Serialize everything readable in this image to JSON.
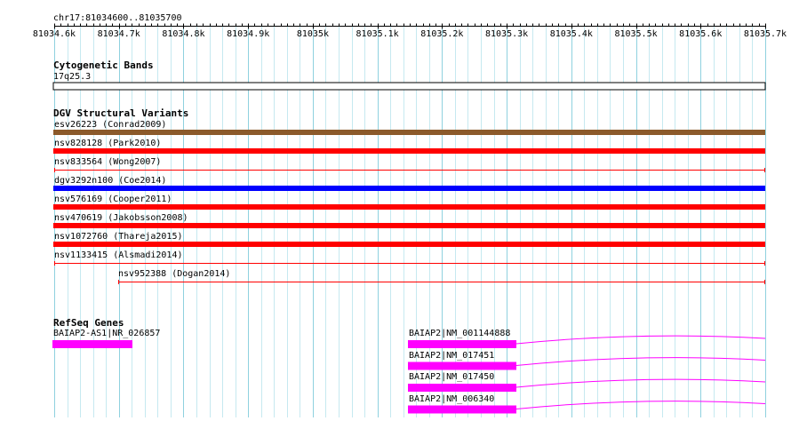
{
  "ruler": {
    "location": "chr17:81034600..81035700",
    "ticks": [
      "81034.6k",
      "81034.7k",
      "81034.8k",
      "81034.9k",
      "81035k",
      "81035.1k",
      "81035.2k",
      "81035.3k",
      "81035.4k",
      "81035.5k",
      "81035.6k",
      "81035.7k"
    ]
  },
  "tracks": {
    "cytoband": {
      "title": "Cytogenetic Bands",
      "band": "17q25.3"
    },
    "dgv": {
      "title": "DGV Structural Variants",
      "features": [
        {
          "label": "esv26223 (Conrad2009)",
          "color": "#8b5a2b",
          "style": "thick",
          "start": 0,
          "end": 1
        },
        {
          "label": "nsv828128 (Park2010)",
          "color": "#ff0000",
          "style": "thick",
          "start": 0,
          "end": 1
        },
        {
          "label": "nsv833564 (Wong2007)",
          "color": "#ff0000",
          "style": "thin",
          "start": 0,
          "end": 1
        },
        {
          "label": "dgv3292n100 (Coe2014)",
          "color": "#0000ff",
          "style": "thick",
          "start": 0,
          "end": 1
        },
        {
          "label": "nsv576169 (Cooper2011)",
          "color": "#ff0000",
          "style": "thick",
          "start": 0,
          "end": 1
        },
        {
          "label": "nsv470619 (Jakobsson2008)",
          "color": "#ff0000",
          "style": "thick",
          "start": 0,
          "end": 1
        },
        {
          "label": "nsv1072760 (Thareja2015)",
          "color": "#ff0000",
          "style": "thick",
          "start": 0,
          "end": 1
        },
        {
          "label": "nsv1133415 (Alsmadi2014)",
          "color": "#ff0000",
          "style": "thin",
          "start": 0,
          "end": 1
        },
        {
          "label": "nsv952388 (Dogan2014)",
          "color": "#ff0000",
          "style": "thin",
          "start": 0.09,
          "end": 1
        }
      ]
    },
    "refseq": {
      "title": "RefSeq Genes",
      "color": "#ff00ff",
      "genes": [
        {
          "label": "BAIAP2-AS1|NR_026857",
          "exonStart": 0,
          "exonEnd": 0.11,
          "intron": false
        },
        {
          "label": "BAIAP2|NM_001144888",
          "exonStart": 0.5,
          "exonEnd": 0.65,
          "intron": true
        },
        {
          "label": "BAIAP2|NM_017451",
          "exonStart": 0.5,
          "exonEnd": 0.65,
          "intron": true
        },
        {
          "label": "BAIAP2|NM_017450",
          "exonStart": 0.5,
          "exonEnd": 0.65,
          "intron": true
        },
        {
          "label": "BAIAP2|NM_006340",
          "exonStart": 0.5,
          "exonEnd": 0.65,
          "intron": true
        }
      ]
    }
  }
}
